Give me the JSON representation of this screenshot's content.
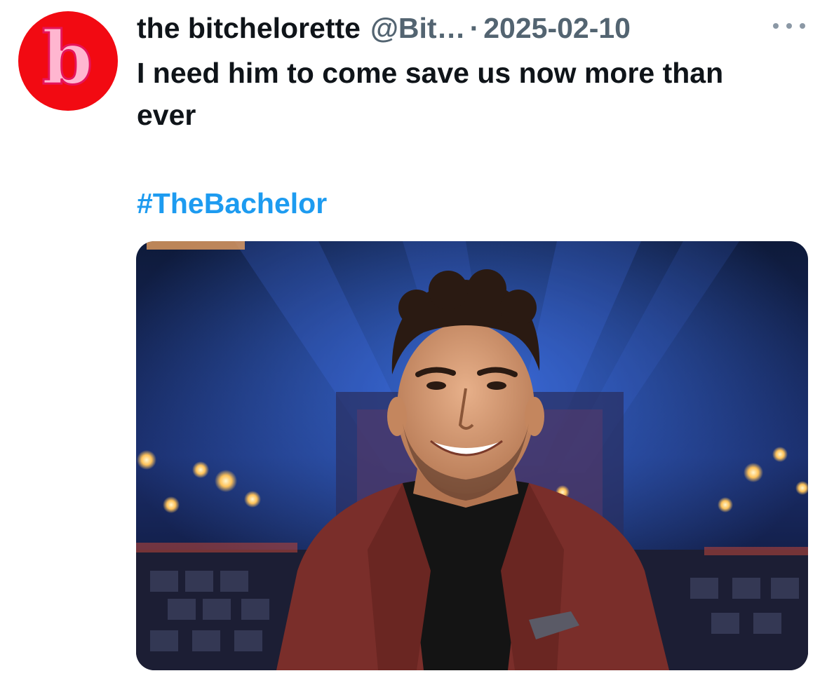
{
  "tweet": {
    "avatar_letter": "b",
    "display_name": "the bitchelorette",
    "handle": "@Bit…",
    "separator": "·",
    "date": "2025-02-10",
    "text": "I need him to come save us now more than ever",
    "hashtag": "#TheBachelor",
    "more_icon": "more-horizontal-icon"
  },
  "colors": {
    "avatar_bg": "#f20a12",
    "hashtag": "#1d9bf0",
    "secondary_text": "#536471",
    "primary_text": "#0f1419"
  }
}
